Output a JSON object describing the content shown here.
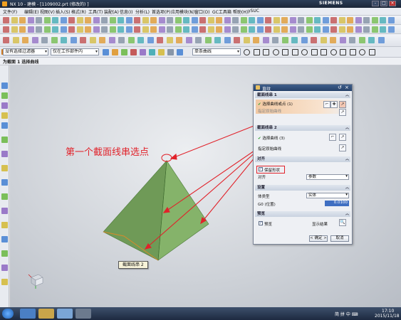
{
  "window": {
    "title": "NX 10 - 建模 - [1109002.prt (修改的) ]",
    "brand": "SIEMENS",
    "controls": [
      "-",
      "□",
      "×"
    ]
  },
  "menu": [
    "文件(F)",
    "编辑(E)",
    "视图(V)",
    "插入(S)",
    "格式(R)",
    "工具(T)",
    "装配(A)",
    "信息(I)",
    "分析(L)",
    "首选项(P)",
    "应用模块(N)",
    "窗口(O)",
    "GC工具箱",
    "帮助(H)",
    "ySUC"
  ],
  "selection_bar": {
    "type_filter": "没有选择过滤器",
    "scope": "仅在工作部件内",
    "curve_rule": "单条曲线"
  },
  "cue_line": "为截面 1 选择曲线",
  "annotation": "第一个截面线串选点",
  "tooltip": "截面线串 2",
  "dialog": {
    "title": "直纹",
    "section1": {
      "header": "截面线串 1",
      "select_label": "选择曲线或点 (1)",
      "origin_label": "指定原始曲线"
    },
    "section2": {
      "header": "截面线串 2",
      "select_label": "选择曲线 (3)",
      "origin_label": "指定原始曲线"
    },
    "alignment": {
      "header": "对齐",
      "preserve_shape": "保留形状",
      "align_label": "对齐",
      "align_value": "参数"
    },
    "settings": {
      "header": "设置",
      "body_type_label": "体类型",
      "body_type_value": "实体",
      "g0_label": "G0 (位置)",
      "g0_value": "0.0100"
    },
    "preview": {
      "header": "预览",
      "preview_label": "预览",
      "show_result": "显示结果"
    },
    "ok": "< 确定 >",
    "cancel": "取消"
  },
  "taskbar": {
    "tray": "简  拼  中  ⌨",
    "time": "17:10",
    "date": "2015/11/18"
  }
}
